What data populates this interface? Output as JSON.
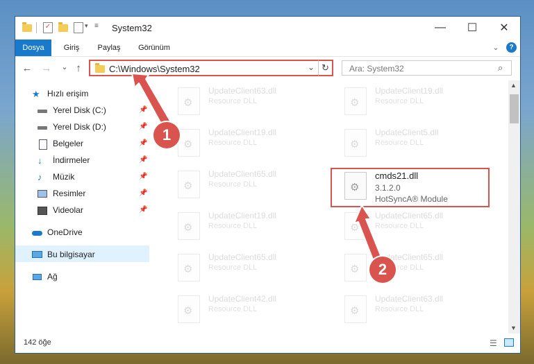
{
  "window": {
    "title": "System32",
    "minimize": "—",
    "maximize": "☐",
    "close": "✕"
  },
  "ribbon": {
    "tabs": [
      "Dosya",
      "Giriş",
      "Paylaş",
      "Görünüm"
    ],
    "collapse": "⌄",
    "help": "?"
  },
  "address": {
    "path": "C:\\Windows\\System32",
    "dropdown": "⌄",
    "refresh": "↻",
    "search_placeholder": "Ara: System32"
  },
  "nav": {
    "back": "←",
    "forward": "→",
    "recent": "⌄",
    "up": "↑"
  },
  "sidebar": {
    "quick_access": "Hızlı erişim",
    "items": [
      "Yerel Disk (C:)",
      "Yerel Disk (D:)",
      "Belgeler",
      "İndirmeler",
      "Müzik",
      "Resimler",
      "Videolar"
    ],
    "onedrive": "OneDrive",
    "this_pc": "Bu bilgisayar",
    "network": "Ağ"
  },
  "files": {
    "left": [
      {
        "name": "UpdateClient63.dll",
        "type": "Resource DLL"
      },
      {
        "name": "UpdateClient19.dll",
        "type": "Resource DLL"
      },
      {
        "name": "UpdateClient65.dll",
        "type": "Resource DLL"
      },
      {
        "name": "UpdateClient19.dll",
        "type": "Resource DLL"
      },
      {
        "name": "UpdateClient65.dll",
        "type": "Resource DLL"
      },
      {
        "name": "UpdateClient42.dll",
        "type": "Resource DLL"
      }
    ],
    "right": [
      {
        "name": "UpdateClient19.dll",
        "type": "Resource DLL"
      },
      {
        "name": "UpdateClient5.dll",
        "type": "Resource DLL"
      },
      {
        "name": "UpdateClient65.dll",
        "type": "Resource DLL"
      },
      {
        "name": "UpdateClient65.dll",
        "type": "Resource DLL"
      },
      {
        "name": "UpdateClient63.dll",
        "type": "Resource DLL"
      }
    ],
    "highlighted": {
      "name": "cmds21.dll",
      "version": "3.1.2.0",
      "description": "HotSyncA® Module"
    }
  },
  "status": {
    "count": "142 öğe"
  },
  "annotations": {
    "step1": "1",
    "step2": "2",
    "color": "#d9534f"
  }
}
